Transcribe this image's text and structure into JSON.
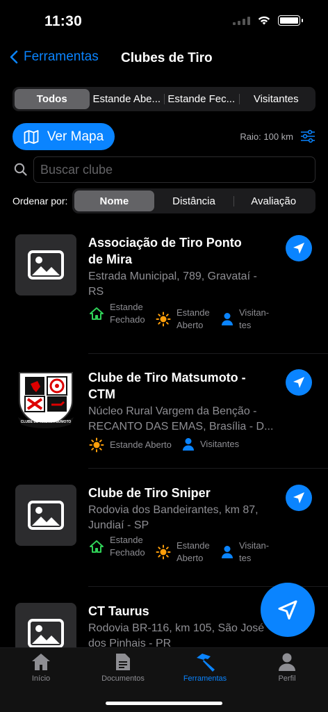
{
  "status": {
    "time": "11:30"
  },
  "nav": {
    "back_label": "Ferramentas",
    "title": "Clubes de Tiro"
  },
  "filter_tabs": [
    "Todos",
    "Estande Abe...",
    "Estande Fec...",
    "Visitantes"
  ],
  "filter_selected": "Todos",
  "map_button": {
    "label": "Ver Mapa"
  },
  "radius": {
    "label": "Raio: 100 km"
  },
  "search": {
    "placeholder": "Buscar clube",
    "value": ""
  },
  "sort": {
    "label": "Ordenar por:",
    "options": [
      "Nome",
      "Distância",
      "Avaliação"
    ],
    "selected": "Nome"
  },
  "clubs": [
    {
      "name": "Associação de Tiro Ponto de Mira",
      "address": "Estrada Municipal, 789, Gravataí - RS",
      "image": "placeholder-image-icon",
      "tags": [
        {
          "icon": "house-icon",
          "label": "Estande Fechado",
          "color": "#30d158"
        },
        {
          "icon": "sun-icon",
          "label": "Estande Aberto",
          "color": "#ff9f0a"
        },
        {
          "icon": "person-icon",
          "label": "Visitan­tes",
          "color": "#0a84ff"
        }
      ]
    },
    {
      "name": "Clube de Tiro Matsumoto - CTM",
      "address": "Núcleo Rural Vargem da Benção - RECANTO DAS EMAS, Brasília - D...",
      "image": "club-logo",
      "logo_text": "CLUBE DE TIRO MATSUMOTO",
      "tags": [
        {
          "icon": "sun-icon",
          "label": "Estande Aberto",
          "color": "#ff9f0a"
        },
        {
          "icon": "person-icon",
          "label": "Visitantes",
          "color": "#0a84ff"
        }
      ]
    },
    {
      "name": "Clube de Tiro Sniper",
      "address": "Rodovia dos Bandeirantes, km 87, Jundiaí - SP",
      "image": "placeholder-image-icon",
      "tags": [
        {
          "icon": "house-icon",
          "label": "Estande Fechado",
          "color": "#30d158"
        },
        {
          "icon": "sun-icon",
          "label": "Estande Aberto",
          "color": "#ff9f0a"
        },
        {
          "icon": "person-icon",
          "label": "Visitan­tes",
          "color": "#0a84ff"
        }
      ]
    },
    {
      "name": "CT Taurus",
      "address": "Rodovia BR-116, km 105, São José dos Pinhais - PR",
      "image": "placeholder-image-icon",
      "tags": []
    }
  ],
  "tab_bar": {
    "items": [
      {
        "label": "Início",
        "icon": "house-icon"
      },
      {
        "label": "Documentos",
        "icon": "document-icon"
      },
      {
        "label": "Ferramentas",
        "icon": "hammer-icon"
      },
      {
        "label": "Perfil",
        "icon": "person-icon"
      }
    ],
    "selected": "Ferramentas"
  },
  "colors": {
    "accent": "#0a84ff",
    "background": "#000000",
    "secondary_text": "#8e8e93",
    "card": "#2c2c2e"
  }
}
